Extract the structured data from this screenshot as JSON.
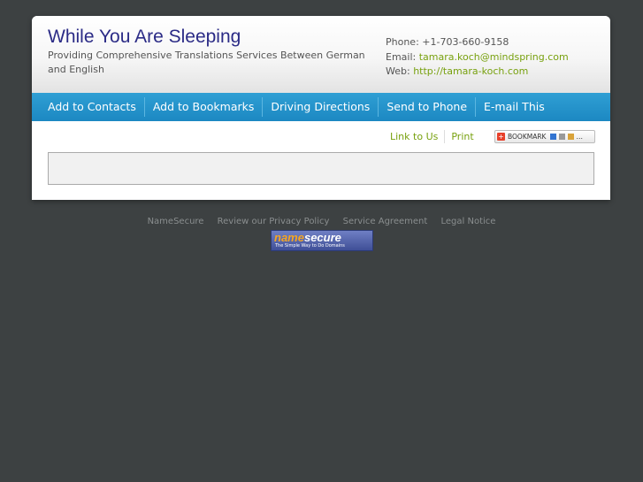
{
  "header": {
    "title": "While You Are Sleeping",
    "tagline": "Providing Comprehensive Translations Services Between German and English",
    "phone_label": "Phone:",
    "phone_value": "+1-703-660-9158",
    "email_label": "Email:",
    "email_value": "tamara.koch@mindspring.com",
    "web_label": "Web:",
    "web_value": "http://tamara-koch.com"
  },
  "nav": {
    "items": [
      {
        "label": "Add to Contacts"
      },
      {
        "label": "Add to Bookmarks"
      },
      {
        "label": "Driving Directions"
      },
      {
        "label": "Send to Phone"
      },
      {
        "label": "E-mail This"
      }
    ]
  },
  "utility": {
    "link_to_us": "Link to Us",
    "print": "Print",
    "bookmark_label": "BOOKMARK"
  },
  "footer": {
    "links": [
      "NameSecure",
      "Review our Privacy Policy",
      "Service Agreement",
      "Legal Notice"
    ],
    "logo_word1": "name",
    "logo_word2": "secure",
    "logo_tagline": "The Simple Way to Do Domains"
  },
  "colors": {
    "background": "#3d4142",
    "title": "#2b2b86",
    "nav": "#1c88c2",
    "link": "#78a10f"
  }
}
